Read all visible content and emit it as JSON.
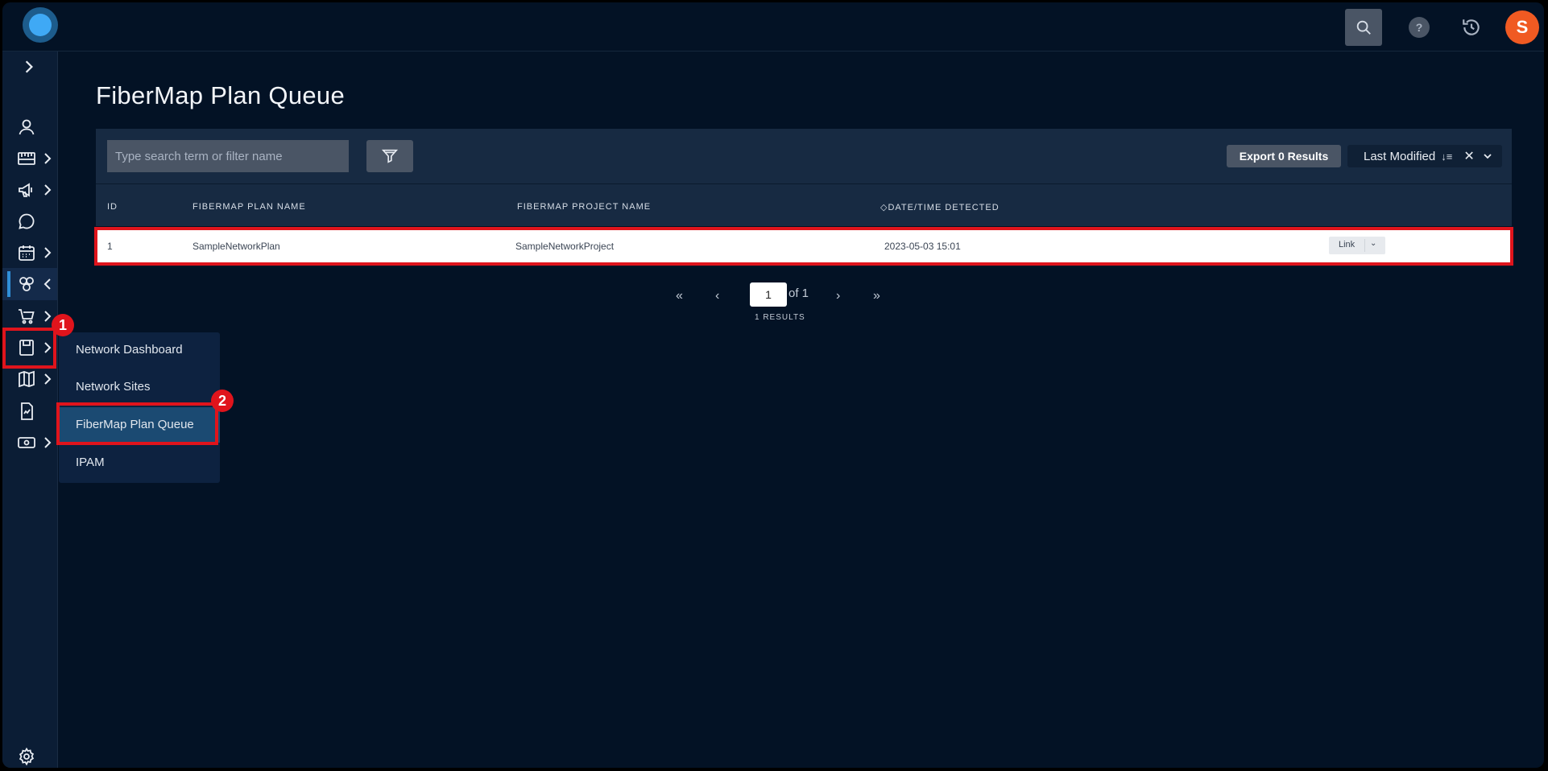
{
  "app": {
    "page_title": "FiberMap Plan Queue",
    "avatar_initial": "S",
    "colors": {
      "accent": "#3fa9f5",
      "avatar": "#f05a22",
      "highlight": "#e0141c",
      "background": "#031225"
    }
  },
  "topbar": {
    "icons": [
      "search-icon",
      "help-icon",
      "history-icon"
    ],
    "help_glyph": "?"
  },
  "sidebar": {
    "items": [
      {
        "name": "user-icon",
        "has_chevron": false
      },
      {
        "name": "ruler-icon",
        "has_chevron": true
      },
      {
        "name": "megaphone-icon",
        "has_chevron": true
      },
      {
        "name": "chat-icon",
        "has_chevron": false
      },
      {
        "name": "calendar-icon",
        "has_chevron": true
      },
      {
        "name": "network-icon",
        "has_chevron": true,
        "active": true
      },
      {
        "name": "cart-icon",
        "has_chevron": true
      },
      {
        "name": "save-icon",
        "has_chevron": true
      },
      {
        "name": "map-icon",
        "has_chevron": true
      },
      {
        "name": "report-icon",
        "has_chevron": false
      },
      {
        "name": "money-icon",
        "has_chevron": true
      }
    ],
    "settings_icon": "gear-icon"
  },
  "submenu": {
    "items": [
      "Network Dashboard",
      "Network Sites",
      "FiberMap Plan Queue",
      "IPAM"
    ],
    "active_index": 2
  },
  "toolbar": {
    "search_placeholder": "Type search term or filter name",
    "export_label": "Export 0 Results",
    "sort_label": "Last Modified",
    "sort_symbol": "↓≡",
    "clear_symbol": "✕"
  },
  "table": {
    "columns": [
      "ID",
      "FIBERMAP PLAN NAME",
      "FIBERMAP PROJECT NAME",
      "◇DATE/TIME DETECTED"
    ],
    "rows": [
      {
        "id": "1",
        "plan_name": "SampleNetworkPlan",
        "project_name": "SampleNetworkProject",
        "detected": "2023-05-03 15:01",
        "action": "Link"
      }
    ]
  },
  "pagination": {
    "first": "«",
    "prev": "‹",
    "current_page": "1",
    "of_label": "of 1",
    "next": "›",
    "last": "»",
    "results_label": "1 RESULTS"
  },
  "annotations": {
    "badge_1": "1",
    "badge_2": "2"
  }
}
